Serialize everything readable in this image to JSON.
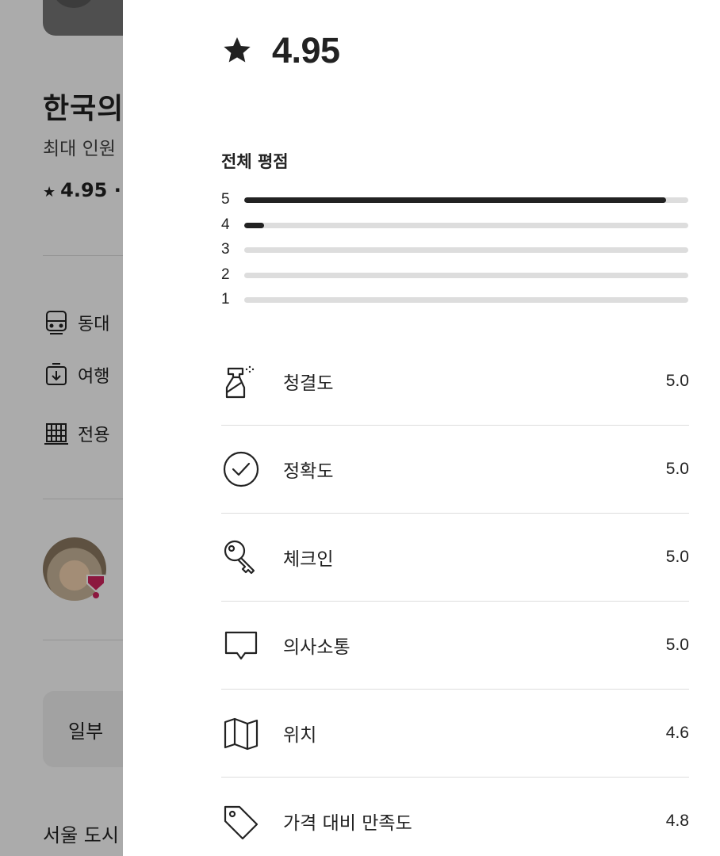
{
  "background": {
    "title": "한국의",
    "subtitle": "최대 인원",
    "rating": "4.95 ·",
    "features": [
      "동대",
      "여행",
      "전용"
    ],
    "button_label": "일부",
    "footer_text": "서울 도시"
  },
  "modal": {
    "overall_score": "4.95",
    "overall_label": "전체 평점",
    "distribution": [
      {
        "stars": "5",
        "fraction": 0.95
      },
      {
        "stars": "4",
        "fraction": 0.045
      },
      {
        "stars": "3",
        "fraction": 0
      },
      {
        "stars": "2",
        "fraction": 0
      },
      {
        "stars": "1",
        "fraction": 0
      }
    ],
    "categories": [
      {
        "label": "청결도",
        "value": "5.0",
        "icon": "spray-bottle-icon"
      },
      {
        "label": "정확도",
        "value": "5.0",
        "icon": "check-circle-icon"
      },
      {
        "label": "체크인",
        "value": "5.0",
        "icon": "key-icon"
      },
      {
        "label": "의사소통",
        "value": "5.0",
        "icon": "speech-bubble-icon"
      },
      {
        "label": "위치",
        "value": "4.6",
        "icon": "map-icon"
      },
      {
        "label": "가격 대비 만족도",
        "value": "4.8",
        "icon": "price-tag-icon"
      }
    ]
  },
  "colors": {
    "text": "#222222",
    "track": "#dddddd",
    "fill": "#222222",
    "overlay": "rgba(0,0,0,0.33)",
    "badge": "#d1245e"
  }
}
